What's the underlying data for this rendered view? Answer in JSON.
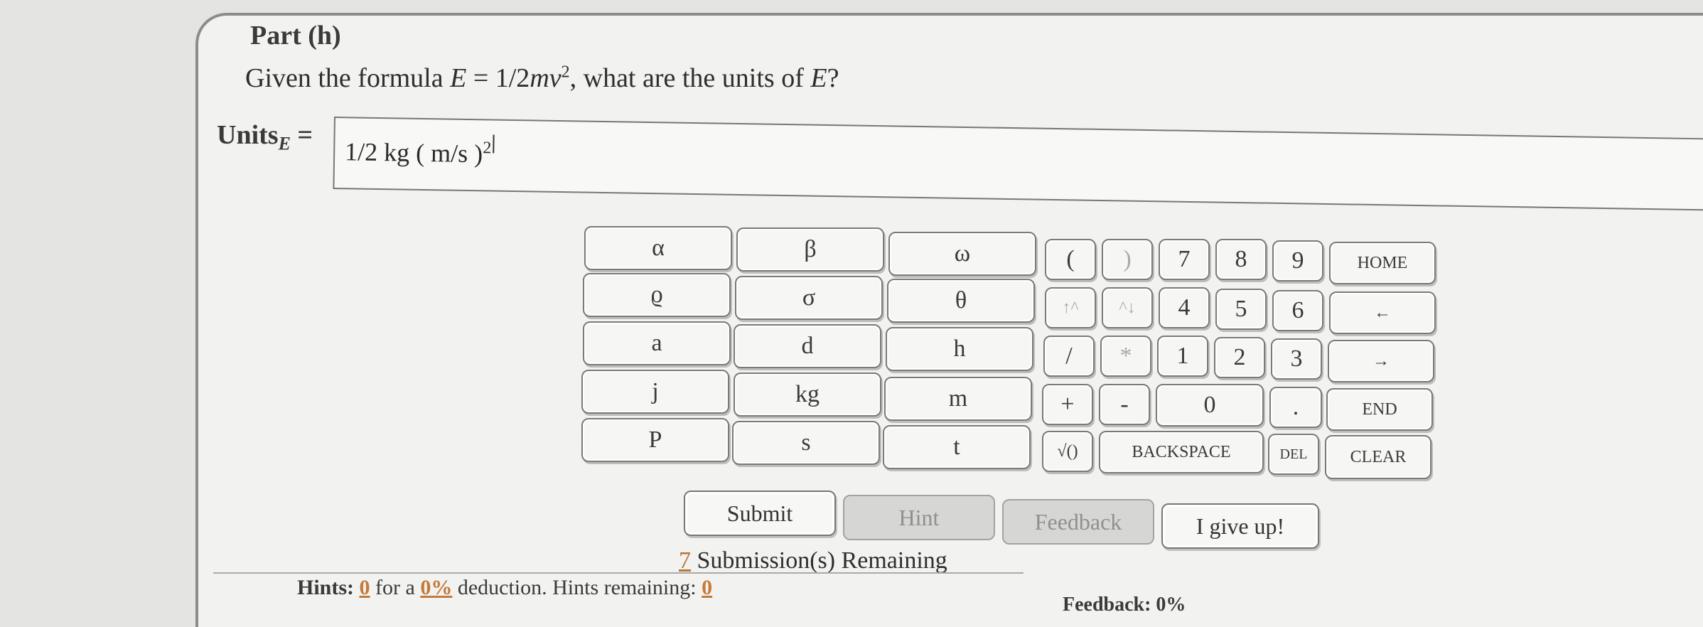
{
  "part_title": "Part (h)",
  "question": {
    "prefix": "Given the formula ",
    "E": "E",
    "equals": " = 1/2",
    "mv": "mv",
    "exp": "2",
    "suffix": ", what are the units of ",
    "E2": "E",
    "end": "?"
  },
  "units_label": {
    "main": "Units",
    "sub": "E",
    "eq": " ="
  },
  "answer": {
    "value": "1/2 kg ( m/s )",
    "exp": "2"
  },
  "keypad": {
    "symbols": [
      "α",
      "β",
      "ω",
      "ϱ",
      "σ",
      "θ",
      "a",
      "d",
      "h",
      "j",
      "kg",
      "m",
      "P",
      "s",
      "t"
    ],
    "row1": [
      "(",
      ")",
      "7",
      "8",
      "9",
      "HOME"
    ],
    "row2": [
      "↑^",
      "^↓",
      "4",
      "5",
      "6",
      "←"
    ],
    "row3": [
      "/",
      "*",
      "1",
      "2",
      "3",
      "→"
    ],
    "row4": [
      "+",
      "-",
      "0",
      ".",
      "END"
    ],
    "row5": [
      "√()",
      "BACKSPACE",
      "DEL",
      "CLEAR"
    ]
  },
  "buttons": {
    "submit": "Submit",
    "hint": "Hint",
    "feedback": "Feedback",
    "give_up": "I give up!"
  },
  "remaining": {
    "count": "7",
    "text": " Submission(s) Remaining"
  },
  "hints": {
    "label": "Hints:",
    "count": "0",
    "for_a": "for a",
    "pct": "0%",
    "deduction": "deduction. Hints remaining:",
    "remaining": "0"
  },
  "feedback_partial": "Feedback: 0%"
}
